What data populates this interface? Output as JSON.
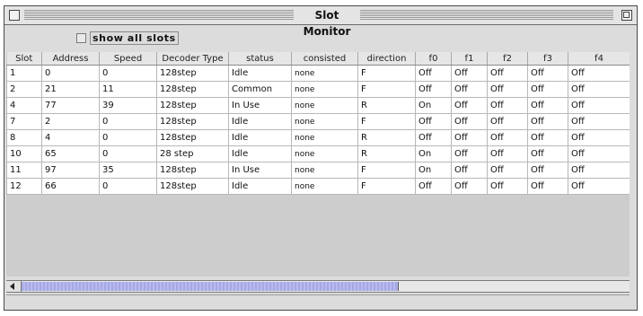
{
  "window": {
    "title": "Slot Monitor"
  },
  "toolbar": {
    "show_all_slots_label": "show all slots",
    "show_all_slots_checked": false
  },
  "table": {
    "headers": [
      "Slot",
      "Address",
      "Speed",
      "Decoder Type",
      "status",
      "consisted",
      "direction",
      "f0",
      "f1",
      "f2",
      "f3",
      "f4"
    ],
    "rows": [
      [
        "1",
        "0",
        "0",
        "128step",
        "Idle",
        "none",
        "F",
        "Off",
        "Off",
        "Off",
        "Off",
        "Off"
      ],
      [
        "2",
        "21",
        "11",
        "128step",
        "Common",
        "none",
        "F",
        "Off",
        "Off",
        "Off",
        "Off",
        "Off"
      ],
      [
        "4",
        "77",
        "39",
        "128step",
        "In Use",
        "none",
        "R",
        "On",
        "Off",
        "Off",
        "Off",
        "Off"
      ],
      [
        "7",
        "2",
        "0",
        "128step",
        "Idle",
        "none",
        "F",
        "Off",
        "Off",
        "Off",
        "Off",
        "Off"
      ],
      [
        "8",
        "4",
        "0",
        "128step",
        "Idle",
        "none",
        "R",
        "Off",
        "Off",
        "Off",
        "Off",
        "Off"
      ],
      [
        "10",
        "65",
        "0",
        "28 step",
        "Idle",
        "none",
        "R",
        "On",
        "Off",
        "Off",
        "Off",
        "Off"
      ],
      [
        "11",
        "97",
        "35",
        "128step",
        "In Use",
        "none",
        "F",
        "On",
        "Off",
        "Off",
        "Off",
        "Off"
      ],
      [
        "12",
        "66",
        "0",
        "128step",
        "Idle",
        "none",
        "F",
        "Off",
        "Off",
        "Off",
        "Off",
        "Off"
      ]
    ]
  },
  "scrollbar": {
    "horizontal_position": 0,
    "visible_fraction": 0.62
  },
  "colors": {
    "scroll_thumb": "#aeb0e8",
    "window_background": "#dcdcdc"
  }
}
